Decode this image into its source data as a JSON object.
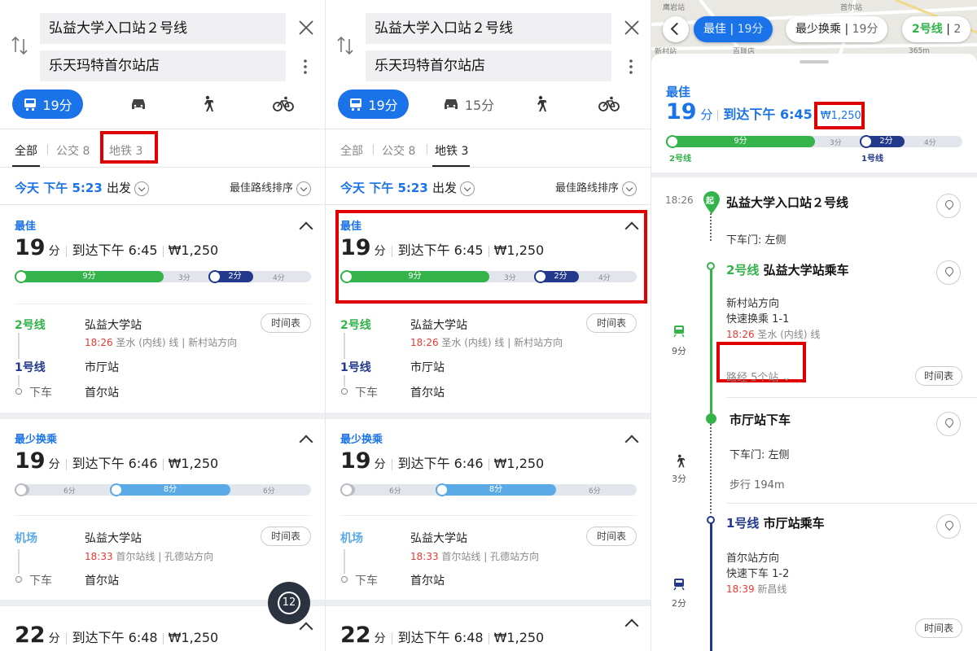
{
  "search": {
    "origin": "弘益大学入口站２号线",
    "destination": "乐天玛特首尔站店"
  },
  "modes": {
    "transit": "19分",
    "car_p2": "15分"
  },
  "filters": {
    "all": "全部",
    "bus": "公交",
    "bus_count": "8",
    "subway": "地铁",
    "subway_count": "3"
  },
  "depart": {
    "day": "今天",
    "time": "下午 5:23",
    "action": "出发",
    "sort": "最佳路线排序"
  },
  "card1": {
    "tag": "最佳",
    "minutes": "19",
    "unit": "分",
    "arrive": "到达下午 6:45",
    "fare": "₩1,250",
    "bar": {
      "seg1": "9分",
      "gap1": "3分",
      "seg2": "2分",
      "gap2": "4分"
    },
    "rows": [
      {
        "line": "2号线",
        "station": "弘益大学站",
        "time": "18:26",
        "detail": "圣水 (内线) 线 | 新村站方向"
      },
      {
        "line": "1号线",
        "station": "市厅站"
      },
      {
        "line": "下车",
        "station": "首尔站"
      }
    ],
    "timetable": "时间表"
  },
  "card2": {
    "tag": "最少换乘",
    "minutes": "19",
    "unit": "分",
    "arrive": "到达下午 6:46",
    "fare": "₩1,250",
    "bar": {
      "w": "6分",
      "seg": "8分",
      "w2": "6分"
    },
    "rows": [
      {
        "line": "机场",
        "station": "弘益大学站",
        "time": "18:33",
        "detail": "首尔站线 | 孔德站方向"
      },
      {
        "line": "下车",
        "station": "首尔站"
      }
    ],
    "timetable": "时间表"
  },
  "card3": {
    "minutes": "22",
    "unit": "分",
    "arrive": "到达下午 6:48",
    "fare": "₩1,250"
  },
  "fab": "12",
  "detail": {
    "chips": [
      {
        "label": "最佳",
        "time": "19分"
      },
      {
        "label": "最少换乘",
        "time": "19分"
      },
      {
        "label": "2号线",
        "time": "2"
      }
    ],
    "map_labels": [
      "鹰岩站",
      "新村站",
      "百联店",
      "首尔站",
      "365m"
    ],
    "title": "最佳",
    "minutes": "19",
    "unit": "分",
    "arrive": "到达下午 6:45",
    "fare": "₩1,250",
    "bar": {
      "seg1": "9分",
      "gap1": "3分",
      "seg2": "2分",
      "gap2": "4分",
      "l1": "2号线",
      "l2": "1号线"
    },
    "start": {
      "time": "18:26",
      "badge": "起",
      "name": "弘益大学入口站２号线",
      "door": "下车门: 左侧"
    },
    "board1": {
      "line": "2号线",
      "name": "弘益大学站乘车",
      "dir": "新村站方向",
      "transfer": "快速换乘 1-1",
      "time": "18:26",
      "line_name": "圣水 (内线) 线",
      "stops": "路经 5个站",
      "mins": "9分"
    },
    "alight1": {
      "name": "市厅站下车",
      "door": "下车门: 左侧",
      "walk": "步行 194m",
      "mins": "3分"
    },
    "board2": {
      "line": "1号线",
      "name": "市厅站乘车",
      "dir": "首尔站方向",
      "transfer": "快速下车 1-2",
      "time": "18:39",
      "line_name": "新昌线",
      "mins": "2分"
    },
    "timetable": "时间表"
  },
  "colors": {
    "blue": "#1a73e8",
    "line2": "#33b34a",
    "line1": "#233a8c",
    "airport": "#5aaae8",
    "highlight": "#e00000"
  }
}
